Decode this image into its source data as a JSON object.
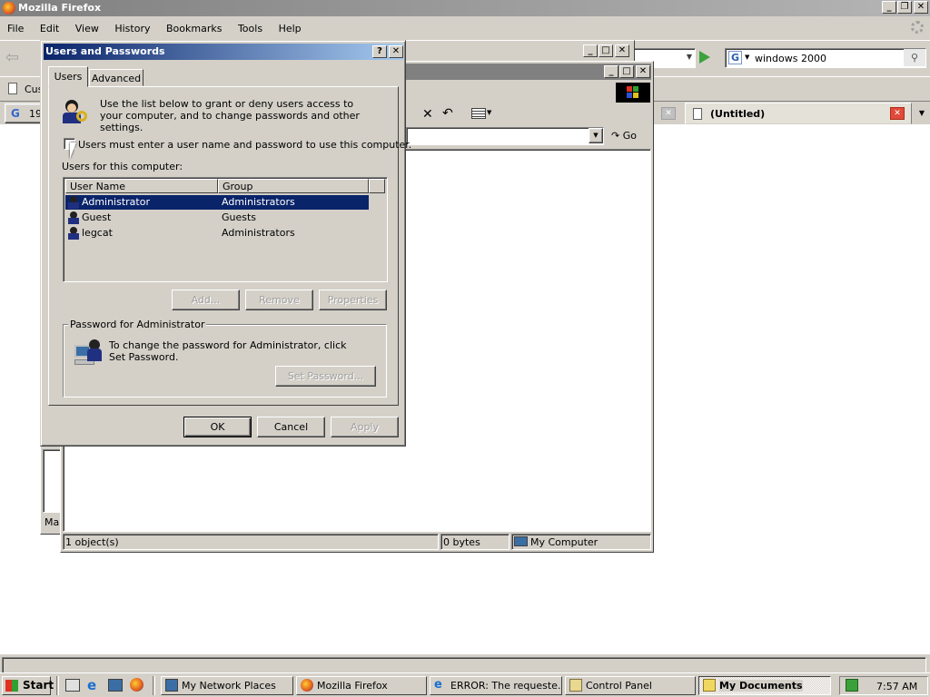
{
  "firefox": {
    "title": "Mozilla Firefox",
    "menu": [
      "File",
      "Edit",
      "View",
      "History",
      "Bookmarks",
      "Tools",
      "Help"
    ],
    "search_value": "windows 2000",
    "bookmark_partial": "Cus",
    "tab1_partial": "19",
    "tab_active": "(Untitled)"
  },
  "explorer": {
    "go_label": "Go",
    "side_partial": "Mar",
    "status_objects": "1 object(s)",
    "status_size": "0 bytes",
    "status_zone": "My Computer"
  },
  "dialog": {
    "title": "Users and Passwords",
    "help_btn": "?",
    "tabs": [
      "Users",
      "Advanced"
    ],
    "intro": "Use the list below to grant or deny users access to your computer, and to change passwords and other settings.",
    "checkbox_label": "Users must enter a user name and password to use this computer.",
    "list_label": "Users for this computer:",
    "columns": [
      "User Name",
      "Group"
    ],
    "users": [
      {
        "name": "Administrator",
        "group": "Administrators",
        "selected": true
      },
      {
        "name": "Guest",
        "group": "Guests",
        "selected": false
      },
      {
        "name": "legcat",
        "group": "Administrators",
        "selected": false
      }
    ],
    "btn_add": "Add...",
    "btn_remove": "Remove",
    "btn_properties": "Properties",
    "pw_group": "Password for Administrator",
    "pw_text": "To change the password for Administrator, click Set Password.",
    "btn_setpw": "Set Password...",
    "btn_ok": "OK",
    "btn_cancel": "Cancel",
    "btn_apply": "Apply"
  },
  "taskbar": {
    "start": "Start",
    "items": [
      "My Network Places",
      "Mozilla Firefox",
      "ERROR: The requeste...",
      "Control Panel",
      "My Documents"
    ],
    "clock": "7:57 AM"
  },
  "colors": {
    "selection": "#0a246a",
    "titlebar_active": "#0a246a",
    "titlebar_inactive": "#808080",
    "face": "#d4d0c8"
  }
}
